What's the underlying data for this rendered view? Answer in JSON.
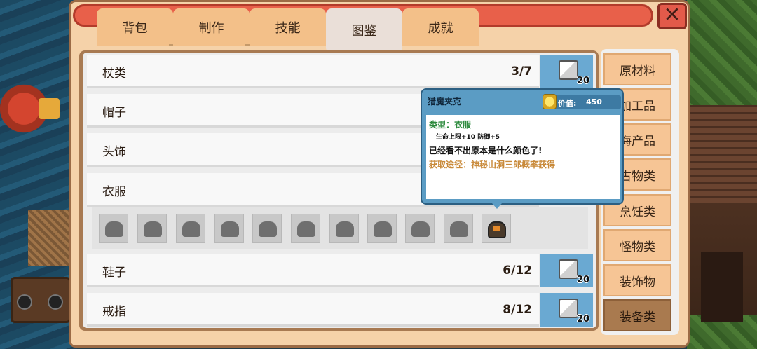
{
  "tabs": [
    {
      "label": "背包"
    },
    {
      "label": "制作"
    },
    {
      "label": "技能"
    },
    {
      "label": "图鉴"
    },
    {
      "label": "成就"
    }
  ],
  "close_icon": "close-icon",
  "rows": [
    {
      "label": "杖类",
      "count": "3/7",
      "reward": "20"
    },
    {
      "label": "帽子",
      "count": "",
      "reward": ""
    },
    {
      "label": "头饰",
      "count": "",
      "reward": ""
    },
    {
      "label": "衣服",
      "count": "",
      "reward": ""
    },
    {
      "label": "鞋子",
      "count": "6/12",
      "reward": "20"
    },
    {
      "label": "戒指",
      "count": "8/12",
      "reward": "20"
    }
  ],
  "categories": [
    {
      "label": "原材料"
    },
    {
      "label": "加工品"
    },
    {
      "label": "海产品"
    },
    {
      "label": "古物类"
    },
    {
      "label": "烹饪类"
    },
    {
      "label": "怪物类"
    },
    {
      "label": "装饰物"
    },
    {
      "label": "装备类"
    }
  ],
  "tooltip": {
    "name": "猎魔夹克",
    "value_label": "价值:",
    "value": "450",
    "type": "类型：衣服",
    "stats": "生命上限+10   防御+5",
    "description": "已经看不出原本是什么颜色了!",
    "source": "获取途径：神秘山洞三郎概率获得"
  },
  "colors": {
    "accent": "#e8604a",
    "tooltip_bg": "#5b9cc4",
    "active_category": "#a97a4f"
  }
}
